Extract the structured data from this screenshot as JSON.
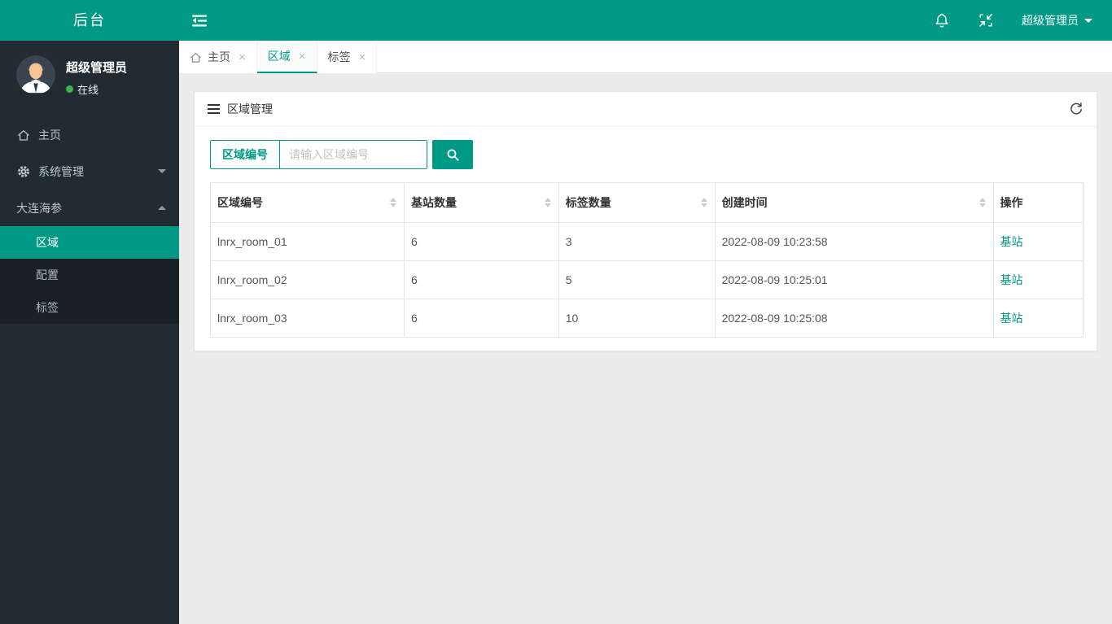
{
  "header": {
    "logo_text": "后台",
    "user_menu_label": "超级管理员",
    "icons": [
      "sidebar-toggle-icon",
      "bell-icon",
      "compress-screen-icon",
      "caret-down-icon"
    ]
  },
  "sidebar": {
    "user": {
      "name": "超级管理员",
      "status": "在线"
    },
    "menu": [
      {
        "label": "主页",
        "icon": "home-icon"
      },
      {
        "label": "系统管理",
        "icon": "gear-icon",
        "state": "collapsed"
      },
      {
        "label": "大连海参",
        "icon": "",
        "state": "expanded"
      }
    ],
    "submenu": [
      {
        "label": "区域",
        "active": true
      },
      {
        "label": "配置",
        "active": false
      },
      {
        "label": "标签",
        "active": false
      }
    ]
  },
  "tabs": [
    {
      "label": "主页",
      "icon": "home-icon",
      "active": false
    },
    {
      "label": "区域",
      "icon": "",
      "active": true
    },
    {
      "label": "标签",
      "icon": "",
      "active": false
    }
  ],
  "ui": {
    "close_glyph": "×"
  },
  "panel": {
    "title": "区域管理",
    "search": {
      "field_label": "区域编号",
      "placeholder": "请输入区域编号"
    },
    "table": {
      "columns": [
        {
          "label": "区域编号",
          "sortable": true
        },
        {
          "label": "基站数量",
          "sortable": true
        },
        {
          "label": "标签数量",
          "sortable": true
        },
        {
          "label": "创建时间",
          "sortable": true
        },
        {
          "label": "操作",
          "sortable": false
        }
      ],
      "rows": [
        {
          "area_id": "lnrx_room_01",
          "base_stations": "6",
          "tags": "3",
          "created_at": "2022-08-09 10:23:58",
          "action": "基站"
        },
        {
          "area_id": "lnrx_room_02",
          "base_stations": "6",
          "tags": "5",
          "created_at": "2022-08-09 10:25:01",
          "action": "基站"
        },
        {
          "area_id": "lnrx_room_03",
          "base_stations": "6",
          "tags": "10",
          "created_at": "2022-08-09 10:25:08",
          "action": "基站"
        }
      ]
    }
  },
  "colors": {
    "accent": "#009985",
    "sidebar_bg": "#232b32",
    "submenu_bg": "#1a2125",
    "content_bg": "#ececec",
    "online_green": "#3bb54a"
  }
}
